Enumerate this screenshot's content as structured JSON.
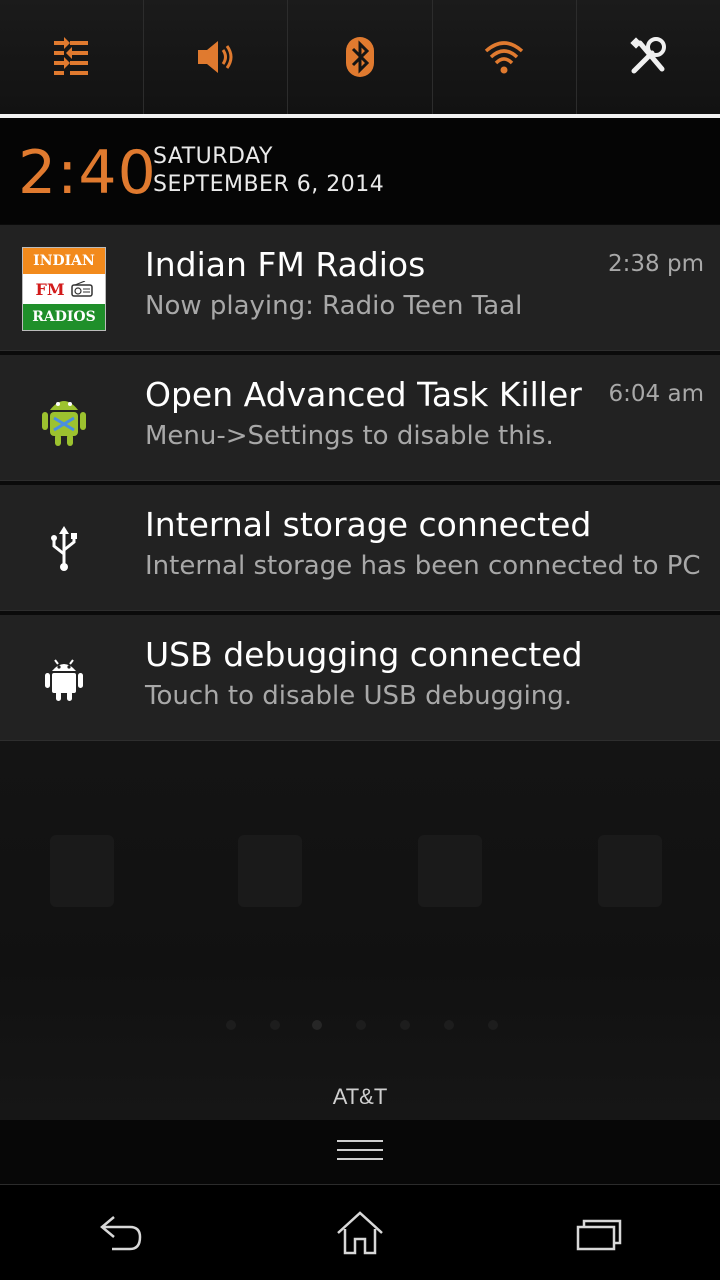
{
  "quick_settings": {
    "items": [
      {
        "name": "settings-list-icon"
      },
      {
        "name": "sound-icon"
      },
      {
        "name": "bluetooth-icon"
      },
      {
        "name": "wifi-icon"
      },
      {
        "name": "tools-icon"
      }
    ],
    "accent_color": "#e07a2f"
  },
  "header": {
    "time": "2:40",
    "day": "SATURDAY",
    "date": "SEPTEMBER 6, 2014"
  },
  "notifications": [
    {
      "title": "Indian FM Radios",
      "text": "Now playing: Radio Teen Taal",
      "time": "2:38 pm",
      "icon": "indian-fm-radios-logo"
    },
    {
      "title": "Open Advanced Task Killer",
      "text": "Menu->Settings to disable this.",
      "time": "6:04 am",
      "icon": "android-robot-icon"
    },
    {
      "title": "Internal storage connected",
      "text": "Internal storage has been connected to PC",
      "time": "",
      "icon": "usb-icon"
    },
    {
      "title": "USB debugging connected",
      "text": "Touch to disable USB debugging.",
      "time": "",
      "icon": "android-debug-icon"
    }
  ],
  "fm_logo": {
    "top": "INDIAN",
    "mid": "FM",
    "bottom": "RADIOS"
  },
  "carrier": "AT&T",
  "nav": {
    "back": "back-icon",
    "home": "home-icon",
    "recents": "recents-icon"
  }
}
